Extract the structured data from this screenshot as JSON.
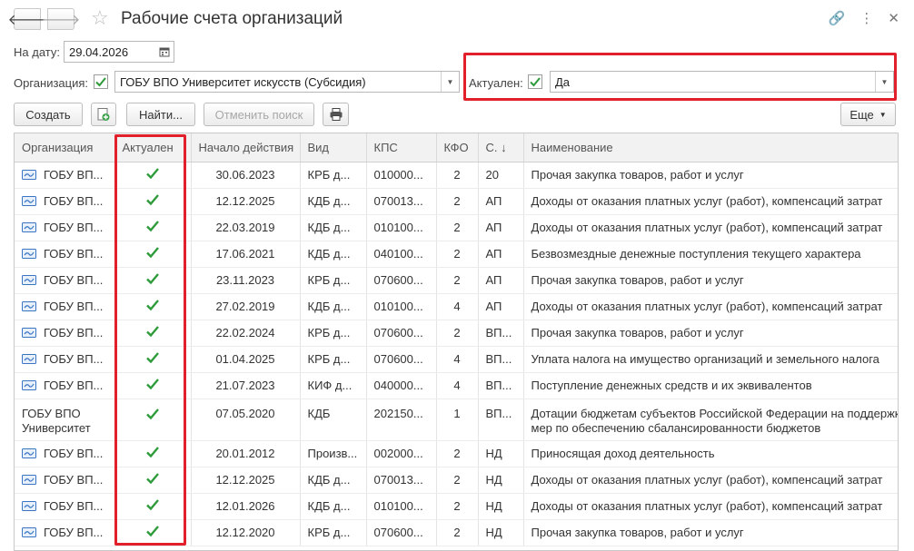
{
  "window": {
    "title": "Рабочие счета организаций",
    "back_glyph": "🡐",
    "fwd_glyph": "🡒",
    "star_glyph": "☆",
    "link_glyph": "🔗",
    "menu_glyph": "⋮",
    "close_glyph": "✕"
  },
  "filters": {
    "date_label": "На дату:",
    "date_value": "29.04.2026",
    "org_label": "Организация:",
    "org_checked": true,
    "org_value": "ГОБУ ВПО Университет искусств (Субсидия)",
    "actual_label": "Актуален:",
    "actual_checked": true,
    "actual_value": "Да"
  },
  "toolbar": {
    "create_label": "Создать",
    "find_label": "Найти...",
    "cancel_search_label": "Отменить поиск",
    "more_label": "Еще",
    "icons": [
      "add-copy-icon",
      "printer-icon"
    ]
  },
  "table": {
    "columns": [
      "Организация",
      "Актуален",
      "Начало действия",
      "Вид",
      "КПС",
      "КФО",
      "С. ↓",
      "Наименование"
    ],
    "rows": [
      {
        "org": "ГОБУ ВП...",
        "actual": true,
        "start": "30.06.2023",
        "vid": "КРБ д...",
        "kps": "010000...",
        "kfo": "2",
        "s": "20",
        "name": "Прочая закупка товаров, работ и услуг"
      },
      {
        "org": "ГОБУ ВП...",
        "actual": true,
        "start": "12.12.2025",
        "vid": "КДБ д...",
        "kps": "070013...",
        "kfo": "2",
        "s": "АП",
        "name": "Доходы от оказания платных услуг (работ), компенсаций затрат"
      },
      {
        "org": "ГОБУ ВП...",
        "actual": true,
        "start": "22.03.2019",
        "vid": "КДБ д...",
        "kps": "010100...",
        "kfo": "2",
        "s": "АП",
        "name": "Доходы от оказания платных услуг (работ), компенсаций затрат"
      },
      {
        "org": "ГОБУ ВП...",
        "actual": true,
        "start": "17.06.2021",
        "vid": "КДБ д...",
        "kps": "040100...",
        "kfo": "2",
        "s": "АП",
        "name": "Безвозмездные денежные поступления текущего характера"
      },
      {
        "org": "ГОБУ ВП...",
        "actual": true,
        "start": "23.11.2023",
        "vid": "КРБ д...",
        "kps": "070600...",
        "kfo": "2",
        "s": "АП",
        "name": "Прочая закупка товаров, работ и услуг"
      },
      {
        "org": "ГОБУ ВП...",
        "actual": true,
        "start": "27.02.2019",
        "vid": "КДБ д...",
        "kps": "010100...",
        "kfo": "4",
        "s": "АП",
        "name": "Доходы от оказания платных услуг (работ), компенсаций затрат"
      },
      {
        "org": "ГОБУ ВП...",
        "actual": true,
        "start": "22.02.2024",
        "vid": "КРБ д...",
        "kps": "070600...",
        "kfo": "2",
        "s": "ВП...",
        "name": "Прочая закупка товаров, работ и услуг"
      },
      {
        "org": "ГОБУ ВП...",
        "actual": true,
        "start": "01.04.2025",
        "vid": "КРБ д...",
        "kps": "070600...",
        "kfo": "4",
        "s": "ВП...",
        "name": "Уплата налога на имущество организаций и земельного налога"
      },
      {
        "org": "ГОБУ ВП...",
        "actual": true,
        "start": "21.07.2023",
        "vid": "КИФ д...",
        "kps": "040000...",
        "kfo": "4",
        "s": "ВП...",
        "name": "Поступление денежных средств и их эквивалентов"
      },
      {
        "org": "ГОБУ ВПО Университет",
        "actual": true,
        "start": "07.05.2020",
        "vid": "КДБ",
        "kps": "202150...",
        "kfo": "1",
        "s": "ВП...",
        "name": "Дотации бюджетам субъектов Российской Федерации на поддержку мер по обеспечению сбалансированности бюджетов",
        "tall": true
      },
      {
        "org": "ГОБУ ВП...",
        "actual": true,
        "start": "20.01.2012",
        "vid": "Произв...",
        "kps": "002000...",
        "kfo": "2",
        "s": "НД",
        "name": "Приносящая доход деятельность"
      },
      {
        "org": "ГОБУ ВП...",
        "actual": true,
        "start": "12.12.2025",
        "vid": "КДБ д...",
        "kps": "070013...",
        "kfo": "2",
        "s": "НД",
        "name": "Доходы от оказания платных услуг (работ), компенсаций затрат"
      },
      {
        "org": "ГОБУ ВП...",
        "actual": true,
        "start": "12.01.2026",
        "vid": "КДБ д...",
        "kps": "010100...",
        "kfo": "2",
        "s": "НД",
        "name": "Доходы от оказания платных услуг (работ), компенсаций затрат"
      },
      {
        "org": "ГОБУ ВП...",
        "actual": true,
        "start": "12.12.2020",
        "vid": "КРБ д...",
        "kps": "070600...",
        "kfo": "2",
        "s": "НД",
        "name": "Прочая закупка товаров, работ и услуг"
      }
    ]
  },
  "colors": {
    "highlight": "#e2202b",
    "check": "#2e9b3a",
    "row_icon": "#3a75c4"
  }
}
